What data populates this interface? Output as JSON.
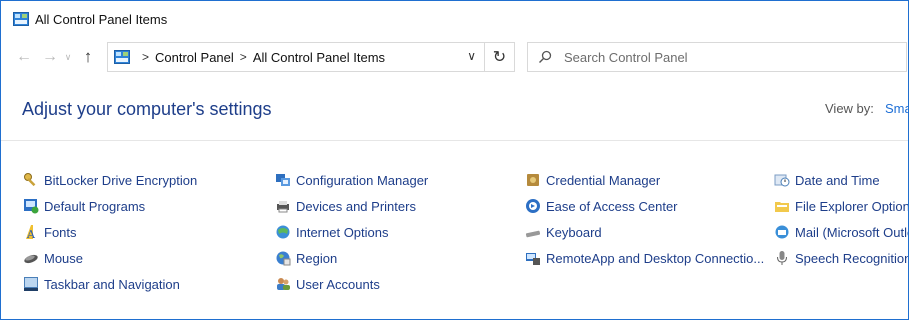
{
  "window": {
    "title": "All Control Panel Items"
  },
  "address": {
    "crumbs": [
      "Control Panel",
      "All Control Panel Items"
    ],
    "separator": ">"
  },
  "search": {
    "placeholder": "Search Control Panel"
  },
  "header": {
    "title": "Adjust your computer's settings",
    "view_by_label": "View by:",
    "view_by_value": "Sma"
  },
  "items": [
    {
      "label": "BitLocker Drive Encryption",
      "icon": "bitlocker-key-icon"
    },
    {
      "label": "Configuration Manager",
      "icon": "configuration-manager-icon"
    },
    {
      "label": "Credential Manager",
      "icon": "credential-vault-icon"
    },
    {
      "label": "Date and Time",
      "icon": "date-time-clock-icon"
    },
    {
      "label": "Default Programs",
      "icon": "default-programs-icon"
    },
    {
      "label": "Devices and Printers",
      "icon": "printer-icon"
    },
    {
      "label": "Ease of Access Center",
      "icon": "ease-of-access-icon"
    },
    {
      "label": "File Explorer Options",
      "icon": "folder-options-icon"
    },
    {
      "label": "Fonts",
      "icon": "fonts-icon"
    },
    {
      "label": "Internet Options",
      "icon": "internet-globe-icon"
    },
    {
      "label": "Keyboard",
      "icon": "keyboard-icon"
    },
    {
      "label": "Mail (Microsoft Outlo",
      "icon": "mail-icon"
    },
    {
      "label": "Mouse",
      "icon": "mouse-icon"
    },
    {
      "label": "Region",
      "icon": "region-globe-icon"
    },
    {
      "label": "RemoteApp and Desktop Connectio...",
      "icon": "remoteapp-icon"
    },
    {
      "label": "Speech Recognition",
      "icon": "microphone-icon"
    },
    {
      "label": "Taskbar and Navigation",
      "icon": "taskbar-icon"
    },
    {
      "label": "User Accounts",
      "icon": "user-accounts-icon"
    }
  ]
}
